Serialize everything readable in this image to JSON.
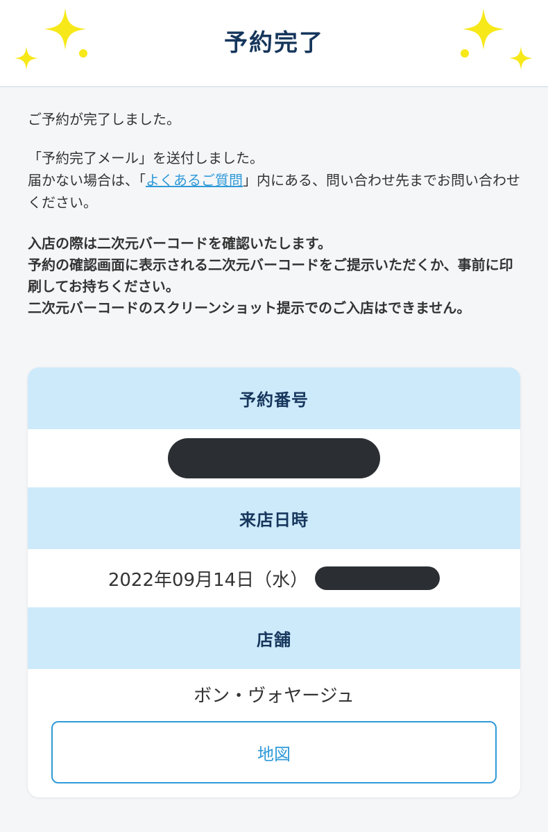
{
  "header": {
    "title": "予約完了"
  },
  "message": {
    "line1": "ご予約が完了しました。",
    "line2": "「予約完了メール」を送付しました。",
    "line3_prefix": "届かない場合は、「",
    "faq_link": "よくあるご質問",
    "line3_suffix": "」内にある、問い合わせ先までお問い合わせください。",
    "notice": [
      "入店の際は二次元バーコードを確認いたします。",
      "予約の確認画面に表示される二次元バーコードをご提示いただくか、事前に印刷してお持ちください。",
      "二次元バーコードのスクリーンショット提示でのご入店はできません。"
    ]
  },
  "reservation": {
    "number_label": "予約番号",
    "datetime_label": "来店日時",
    "date_value": "2022年09月14日（水）",
    "store_label": "店舗",
    "store_value": "ボン・ヴォヤージュ",
    "map_button": "地図"
  },
  "colors": {
    "title": "#16365c",
    "accent": "#2f9ad8",
    "section_bg": "#cdeafb",
    "sparkle": "#f7e81a",
    "redaction": "#2b2f33"
  }
}
